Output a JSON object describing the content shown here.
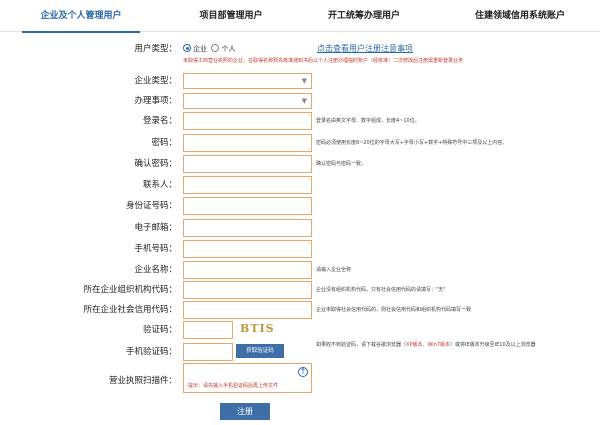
{
  "tabs": [
    {
      "label": "企业及个人管理用户",
      "active": true
    },
    {
      "label": "项目部管理用户",
      "active": false
    },
    {
      "label": "开工统筹办理用户",
      "active": false
    },
    {
      "label": "住建领域信用系统账户",
      "active": false
    }
  ],
  "user_type": {
    "label": "用户类型：",
    "options": [
      "企业",
      "个人"
    ],
    "selected": "企业",
    "notice_link": "点击查看用户注册注意事项",
    "red_note": "未取得工商营业执照的企业，在取得名称预先核准通知书后以个人注册办理临时账户（经核准）二次修改后注册需重新登录业务"
  },
  "fields": {
    "company_type": {
      "label": "企业类型："
    },
    "business_item": {
      "label": "办理事项："
    },
    "login_name": {
      "label": "登录名：",
      "hint": "登录名由英文字母、数字组成，长度4~10位。"
    },
    "password": {
      "label": "密码：",
      "hint": "密码必须使用长度8~20位的字母大写+字母小写+数字+特殊符号中三项及以上内容。"
    },
    "confirm_password": {
      "label": "确认密码：",
      "hint": "确认密码与密码一致。"
    },
    "contact": {
      "label": "联系人："
    },
    "id_number": {
      "label": "身份证号码："
    },
    "email": {
      "label": "电子邮箱："
    },
    "phone": {
      "label": "手机号码："
    },
    "company_name": {
      "label": "企业名称：",
      "hint": "请输入企业全称"
    },
    "org_code": {
      "label": "所在企业组织机构代码：",
      "hint": "企业没有组织机构代码，只有社会信用代码的请填写：\"无\""
    },
    "credit_code": {
      "label": "所在企业社会信用代码：",
      "hint": "企业未取得社会信用代码的，则社会信用代码和组织机构代码填写一致"
    },
    "captcha": {
      "label": "验证码：",
      "image_text": "BTIS"
    },
    "sms_code": {
      "label": "手机验证码：",
      "button": "获取验证码",
      "hint_a": "如果收不到验证码，请下载谷歌浏览器（",
      "hint_red": "XP版本、Win7版本",
      "hint_b": "）或将IE版本升级至IE10及以上浏览器"
    },
    "license_scan": {
      "label": "营业执照扫描件：",
      "upload_hint": "提示：请先输入手机验证码后再上传文件"
    }
  },
  "submit_label": "注册",
  "colors": {
    "accent": "#2a6aa8",
    "button": "#3d6fa6",
    "input_border": "#e5a66b",
    "warning": "#c0392b"
  }
}
